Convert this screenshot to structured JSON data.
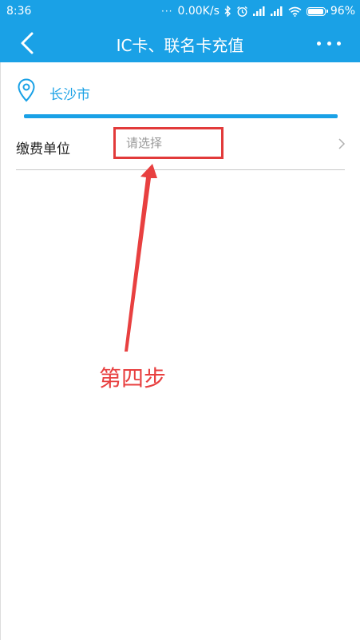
{
  "status_bar": {
    "time": "8:36",
    "dots": "···",
    "network_speed": "0.00K/s",
    "battery": "96%",
    "battery_level": 0.96
  },
  "header": {
    "title": "IC卡、联名卡充值"
  },
  "location": {
    "city": "长沙市"
  },
  "form": {
    "payment_unit_label": "缴费单位",
    "payment_unit_placeholder": "请选择"
  },
  "annotation": {
    "step_text": "第四步",
    "color": "#e84040"
  },
  "colors": {
    "accent": "#1aa1e6",
    "highlight_border": "#e23a3a"
  }
}
